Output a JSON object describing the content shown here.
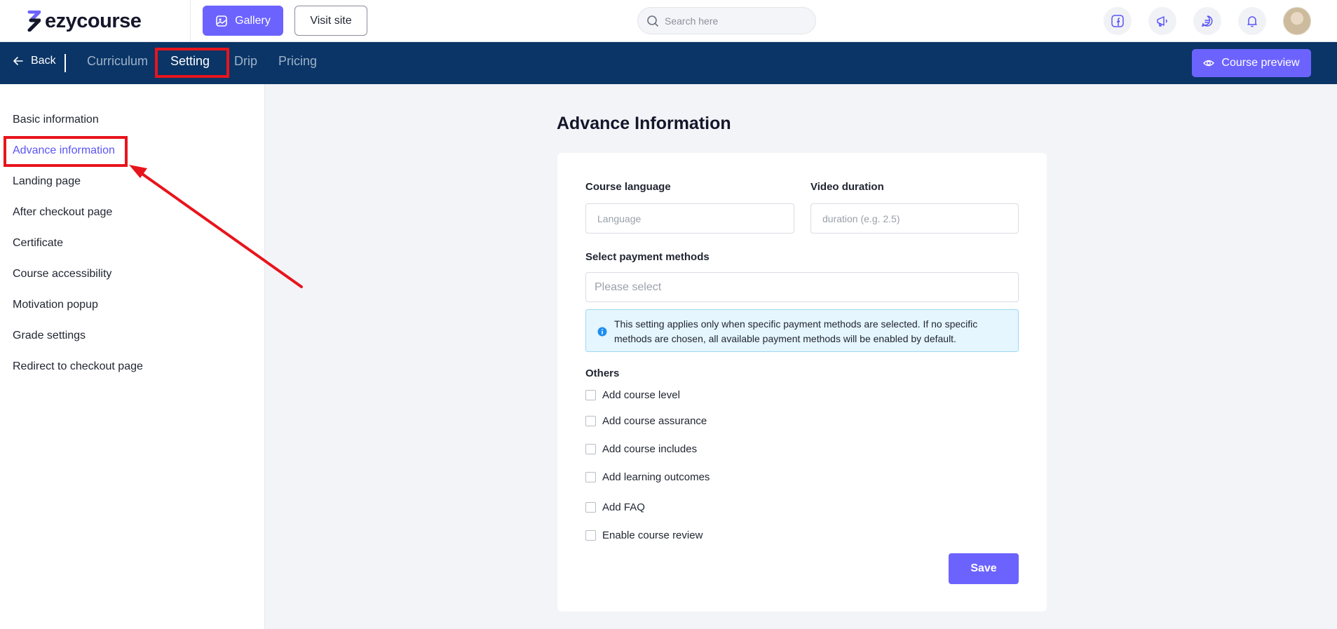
{
  "header": {
    "logo_text": "ezycourse",
    "gallery_label": "Gallery",
    "visit_site_label": "Visit site",
    "search_placeholder": "Search here",
    "icons": [
      "facebook-icon",
      "megaphone-icon",
      "chat-icon",
      "bell-icon"
    ]
  },
  "nav": {
    "back_label": "Back",
    "tabs": [
      {
        "label": "Curriculum",
        "active": false
      },
      {
        "label": "Setting",
        "active": true
      },
      {
        "label": "Drip",
        "active": false
      },
      {
        "label": "Pricing",
        "active": false
      }
    ],
    "preview_label": "Course preview"
  },
  "sidebar": {
    "items": [
      {
        "label": "Basic information",
        "active": false
      },
      {
        "label": "Advance information",
        "active": true
      },
      {
        "label": "Landing page",
        "active": false
      },
      {
        "label": "After checkout page",
        "active": false
      },
      {
        "label": "Certificate",
        "active": false
      },
      {
        "label": "Course accessibility",
        "active": false
      },
      {
        "label": "Motivation popup",
        "active": false
      },
      {
        "label": "Grade settings",
        "active": false
      },
      {
        "label": "Redirect to checkout page",
        "active": false
      }
    ]
  },
  "main": {
    "title": "Advance Information",
    "course_language": {
      "label": "Course language",
      "placeholder": "Language",
      "value": ""
    },
    "video_duration": {
      "label": "Video duration",
      "placeholder": "duration (e.g. 2.5)",
      "value": ""
    },
    "payment_methods": {
      "label": "Select payment methods",
      "placeholder": "Please select"
    },
    "info_text": "This setting applies only when specific payment methods are selected. If no specific methods are chosen, all available payment methods will be enabled by default.",
    "others_label": "Others",
    "options": [
      {
        "label": "Add course level",
        "checked": false
      },
      {
        "label": "Add course assurance",
        "checked": false
      },
      {
        "label": "Add course includes",
        "checked": false
      },
      {
        "label": "Add learning outcomes",
        "checked": false
      },
      {
        "label": "Add FAQ",
        "checked": false
      },
      {
        "label": "Enable course review",
        "checked": false
      }
    ],
    "save_label": "Save"
  },
  "colors": {
    "primary": "#6c63ff",
    "navbar": "#0a3566",
    "annotation": "#e8141c",
    "info_bg": "#e5f6fe"
  }
}
